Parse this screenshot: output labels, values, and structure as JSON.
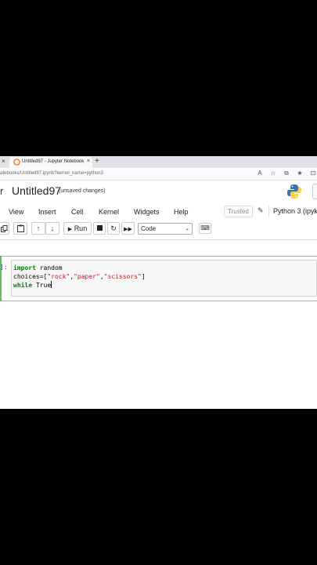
{
  "browser": {
    "tab_title": "Untitled97 - Jupyter Notebook",
    "tab_close": "×",
    "prev_tab_close": "×",
    "new_tab": "+",
    "url": "atebooks/Untitled97.ipynb?kernel_name=python3",
    "addr_icons": [
      "A",
      "☆",
      "⧉",
      "★",
      "⊡"
    ]
  },
  "notebook": {
    "logo_fragment": "r",
    "title": "Untitled97",
    "save_status": "(unsaved changes)"
  },
  "menu": {
    "items": [
      "View",
      "Insert",
      "Cell",
      "Kernel",
      "Widgets",
      "Help"
    ],
    "trusted": "Trusted",
    "kernel": "Python 3 (ipyk"
  },
  "toolbar": {
    "run_label": "Run",
    "cell_type": "Code"
  },
  "cell": {
    "prompt": "]:",
    "code_lines": [
      {
        "kw": "import",
        "rest": " random"
      },
      {
        "text": "choices=[",
        "s1": "\"rock\"",
        "c1": ",",
        "s2": "\"paper\"",
        "c2": ",",
        "s3": "\"scissors\"",
        "end": "]"
      },
      {
        "kw": "while",
        "rest": " True"
      }
    ]
  },
  "colors": {
    "accent_green": "#66bb6a",
    "keyword": "#008000",
    "string": "#ba2121"
  }
}
